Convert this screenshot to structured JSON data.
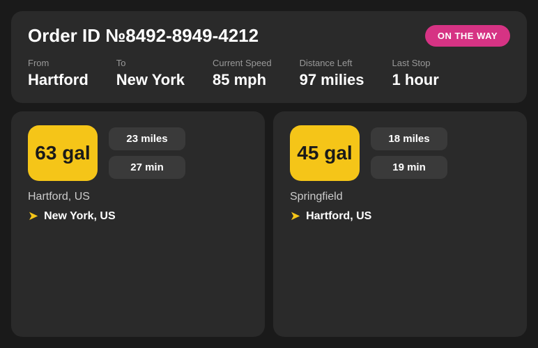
{
  "header": {
    "order_id_label": "Order ID №8492-8949-4212",
    "status_badge": "ON THE WAY"
  },
  "trip_info": {
    "from_label": "From",
    "from_value": "Hartford",
    "to_label": "To",
    "to_value": "New York",
    "speed_label": "Current Speed",
    "speed_value": "85 mph",
    "distance_label": "Distance Left",
    "distance_value": "97 milies",
    "last_stop_label": "Last Stop",
    "last_stop_value": "1 hour"
  },
  "cards": [
    {
      "fuel": "63 gal",
      "miles": "23 miles",
      "minutes": "27 min",
      "from_location": "Hartford, US",
      "to_location": "New York, US"
    },
    {
      "fuel": "45 gal",
      "miles": "18 miles",
      "minutes": "19 min",
      "from_location": "Springfield",
      "to_location": "Hartford, US"
    }
  ]
}
